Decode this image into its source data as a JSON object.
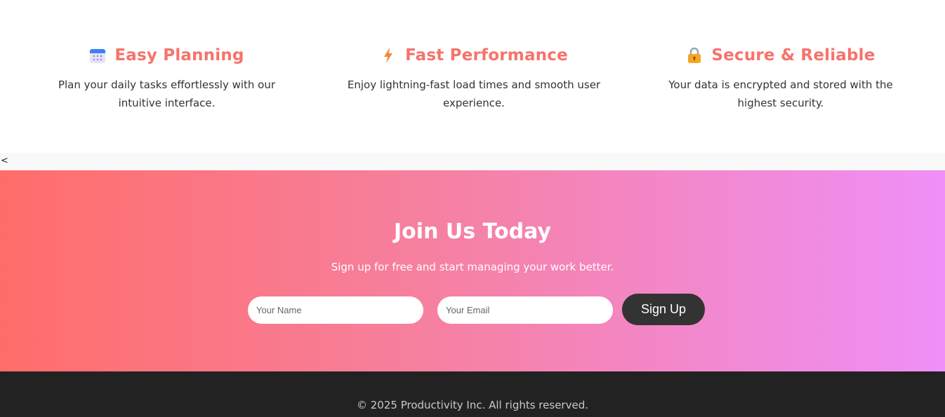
{
  "features": [
    {
      "icon": "calendar-icon",
      "title": "Easy Planning",
      "text": "Plan your daily tasks effortlessly with our intuitive interface."
    },
    {
      "icon": "lightning-icon",
      "title": "Fast Performance",
      "text": "Enjoy lightning-fast load times and smooth user experience."
    },
    {
      "icon": "lock-icon",
      "title": "Secure & Reliable",
      "text": "Your data is encrypted and stored with the highest security."
    }
  ],
  "stray_text": "<",
  "cta": {
    "title": "Join Us Today",
    "subtitle": "Sign up for free and start managing your work better.",
    "name_placeholder": "Your Name",
    "email_placeholder": "Your Email",
    "button_label": "Sign Up"
  },
  "footer": {
    "text": "© 2025 Productivity Inc. All rights reserved."
  },
  "colors": {
    "accent": "#f6736b",
    "gradient_start": "#ff6d6a",
    "gradient_end": "#ef8ff8",
    "button": "#333333",
    "footer_bg": "#222222"
  }
}
